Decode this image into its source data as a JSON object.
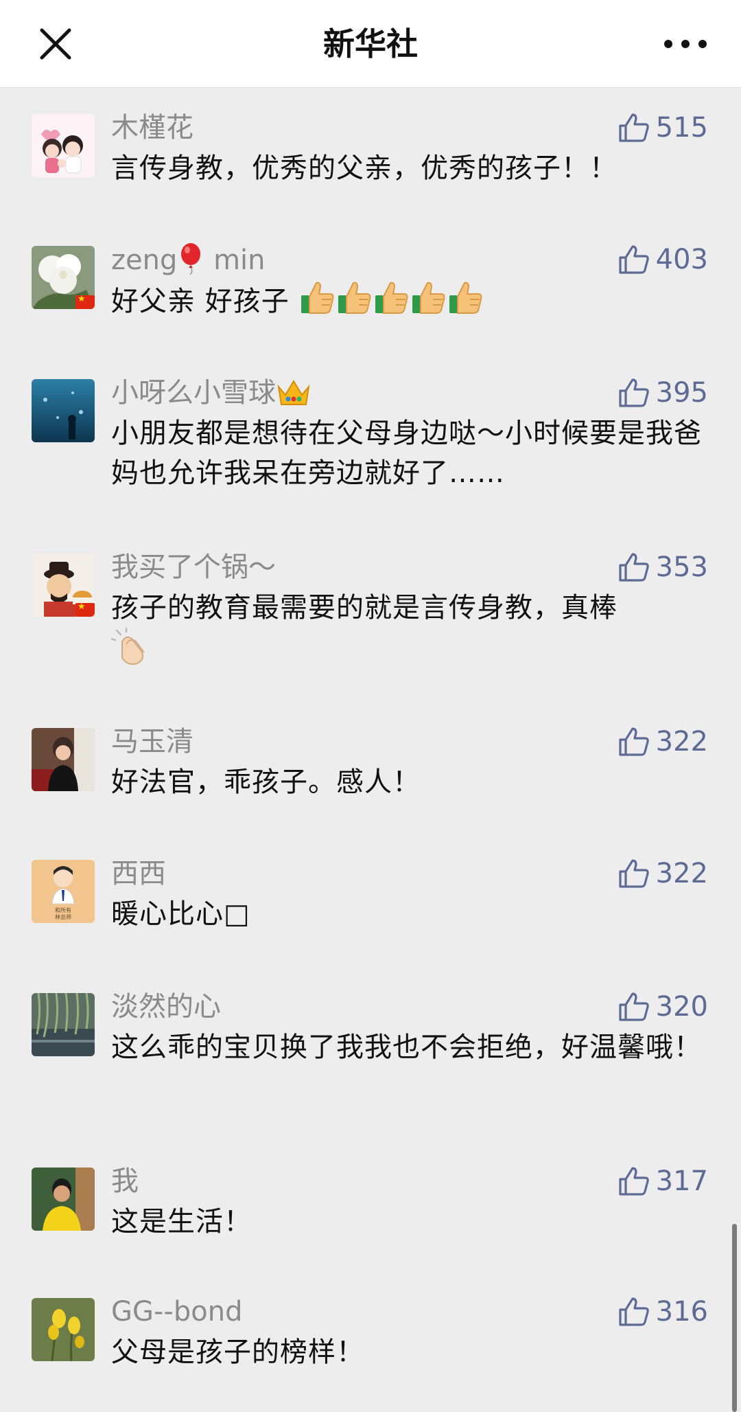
{
  "header": {
    "title": "新华社",
    "close_icon": "close-icon",
    "more_icon": "more-dots-icon"
  },
  "colors": {
    "background": "#ededed",
    "nickname": "#8a8a8a",
    "like_accent": "#5c6a94"
  },
  "comments": [
    {
      "nickname": "木槿花",
      "text": "言传身教，优秀的父亲，优秀的孩子！！",
      "likes": "515",
      "avatar": "cartoon-couple-avatar"
    },
    {
      "nickname_prefix": "zeng",
      "nickname_suffix": "min",
      "nickname_emoji": "balloon-emoji",
      "text": "好父亲 好孩子 ",
      "text_emoji": "thumbs-up-emoji",
      "text_emoji_count": 5,
      "likes": "403",
      "avatar": "white-flower-avatar"
    },
    {
      "nickname": "小呀么小雪球",
      "nickname_emoji": "crown-emoji",
      "text": "小朋友都是想待在父母身边哒～小时候要是我爸妈也允许我呆在旁边就好了……",
      "likes": "395",
      "avatar": "aquarium-avatar"
    },
    {
      "nickname": "我买了个锅～",
      "text": "孩子的教育最需要的就是言传身教，真棒",
      "text_emoji": "clapping-hands-emoji",
      "likes": "353",
      "avatar": "cartoon-official-avatar"
    },
    {
      "nickname": "马玉清",
      "text": "好法官，乖孩子。感人！",
      "likes": "322",
      "avatar": "woman-portrait-avatar"
    },
    {
      "nickname": "西西",
      "text": "暖心比心□",
      "likes": "322",
      "avatar": "cartoon-man-avatar"
    },
    {
      "nickname": "淡然的心",
      "text": "这么乖的宝贝换了我我也不会拒绝，好温馨哦！",
      "likes": "320",
      "avatar": "willow-lake-avatar"
    },
    {
      "nickname": "我",
      "text": "这是生活！",
      "likes": "317",
      "avatar": "man-yellow-shirt-avatar"
    },
    {
      "nickname": "GG--bond",
      "text": "父母是孩子的榜样！",
      "likes": "316",
      "avatar": "yellow-flowers-avatar"
    }
  ],
  "scroll_position": 0.93
}
